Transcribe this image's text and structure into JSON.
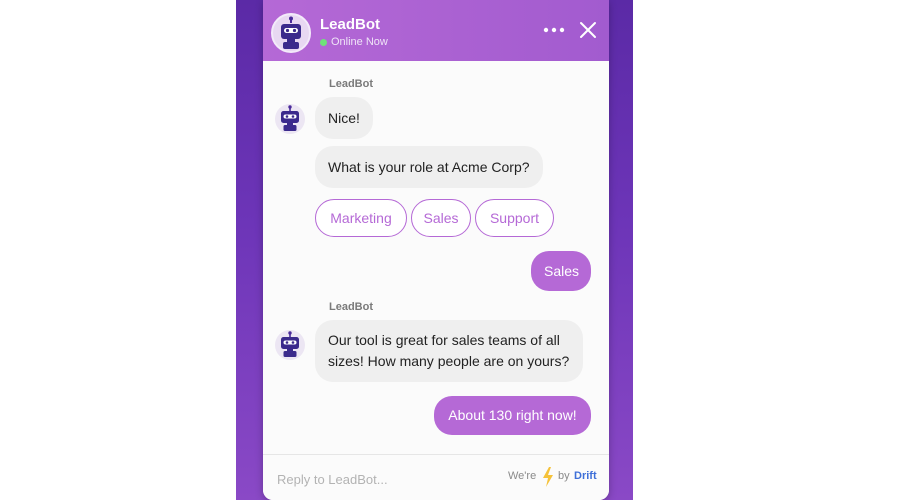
{
  "colors": {
    "accent": "#b569d6",
    "backdrop": "#6d35b8",
    "bubble_in": "#efefef",
    "online": "#6fe27a",
    "brand_blue": "#3e6fd8"
  },
  "header": {
    "bot_name": "LeadBot",
    "status": "Online Now",
    "avatar_icon": "robot-avatar-icon",
    "menu_icon": "more-dots-icon",
    "close_icon": "close-icon"
  },
  "messages": {
    "group1": {
      "sender": "LeadBot",
      "line1": "Nice!",
      "line2": "What is your role at Acme Corp?"
    },
    "quick_replies": [
      "Marketing",
      "Sales",
      "Support"
    ],
    "user_reply1": "Sales",
    "group2": {
      "sender": "LeadBot",
      "text_line1": "Our tool is great for sales teams of all",
      "text_line2": "sizes! How many people are on yours?"
    },
    "user_reply2": "About 130 right now!"
  },
  "composer": {
    "placeholder": "Reply to LeadBot...",
    "powered_pre": "We're",
    "powered_icon": "lightning-bolt-icon",
    "powered_by": "by",
    "brand": "Drift"
  }
}
